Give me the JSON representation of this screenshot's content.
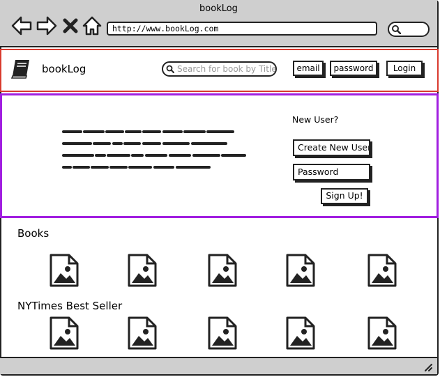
{
  "window": {
    "title": "bookLog"
  },
  "browser": {
    "url": "http://www.bookLog.com"
  },
  "header": {
    "brand": "bookLog",
    "search_placeholder": "Search for book by Title",
    "email_label": "email",
    "password_label": "password",
    "login_label": "Login"
  },
  "hero": {
    "new_user_heading": "New User?",
    "create_user_placeholder": "Create New User",
    "password_placeholder": "Password",
    "signup_label": "Sign Up!"
  },
  "sections": {
    "books_title": "Books",
    "bestseller_title": "NYTimes Best Seller"
  },
  "colors": {
    "header_outline": "#d93a2e",
    "hero_outline": "#a11ee0",
    "chrome": "#cfcfcf"
  }
}
